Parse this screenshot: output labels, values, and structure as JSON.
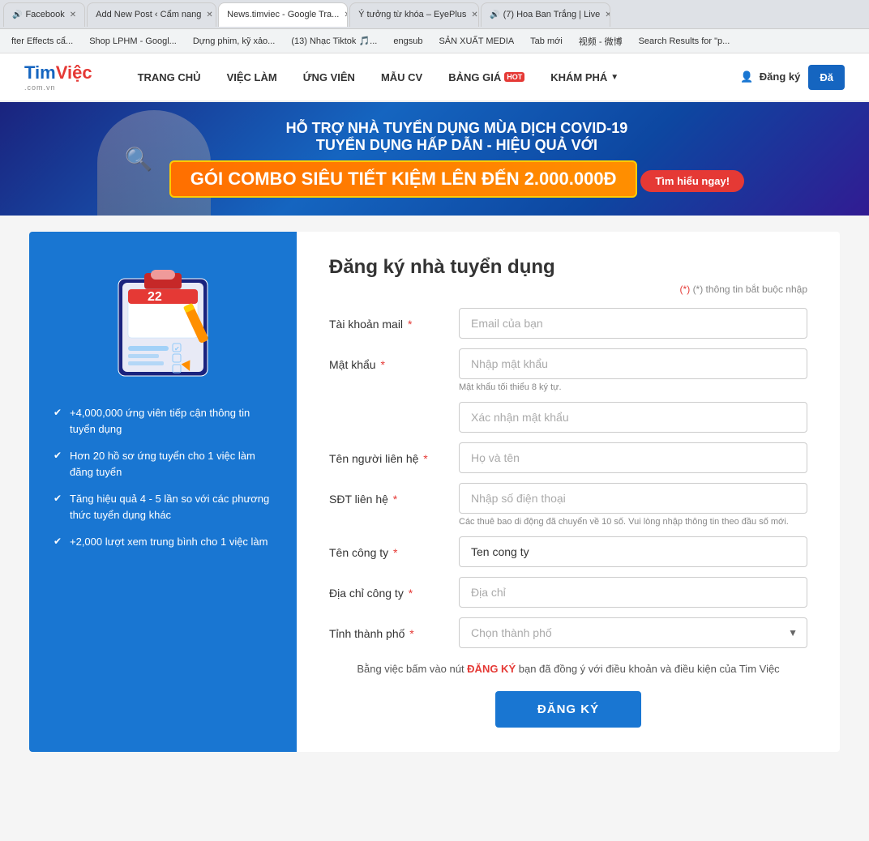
{
  "browser": {
    "tabs": [
      {
        "label": "Facebook",
        "active": false,
        "audio": true
      },
      {
        "label": "Add New Post ‹ Cẩm nang",
        "active": false,
        "audio": false
      },
      {
        "label": "News.timviec - Google Tra...",
        "active": true,
        "audio": false
      },
      {
        "label": "Ý tưởng từ khóa – EyePlus",
        "active": false,
        "audio": false
      },
      {
        "label": "(7) Hoa Ban Trắng | Live",
        "active": false,
        "audio": true
      }
    ],
    "bookmarks": [
      "fter Effects cẩ...",
      "Shop LPHM - Googl...",
      "Dựng phim, kỹ xảo...",
      "(13) Nhạc Tiktok 🎵...",
      "engsub",
      "SẢN XUẤT MEDIA",
      "Tab mới",
      "视频 - 微博",
      "Search Results for \"p..."
    ]
  },
  "header": {
    "logo": "TimViệc",
    "logo_sub": ".com.vn",
    "nav_items": [
      "TRANG CHỦ",
      "VIỆC LÀM",
      "ỨNG VIÊN",
      "MẪU CV",
      "BẢNG GIÁ",
      "KHÁM PHÁ"
    ],
    "bảng_giá_badge": "HOT",
    "btn_dangky": "Đăng ký",
    "btn_dangnhap": "Đă"
  },
  "banner": {
    "line1": "HỖ TRỢ NHÀ TUYỂN DỤNG MÙA DỊCH COVID-19",
    "line2": "TUYỂN DỤNG HẤP DẪN - HIỆU QUẢ VỚI",
    "cta": "GÓI COMBO SIÊU TIẾT KIỆM LÊN ĐẾN 2.000.000Đ",
    "btn": "Tìm hiểu ngay!"
  },
  "left_panel": {
    "features": [
      "+4,000,000 ứng viên tiếp cận thông tin tuyển dụng",
      "Hơn 20 hồ sơ ứng tuyển cho 1 việc làm đăng tuyển",
      "Tăng hiệu quả 4 - 5 lần so với các phương thức tuyển dụng khác",
      "+2,000 lượt xem trung bình cho 1 việc làm"
    ]
  },
  "form": {
    "title": "Đăng ký nhà tuyển dụng",
    "required_note": "(*) thông tin bắt buộc nhập",
    "fields": {
      "email_label": "Tài khoản mail",
      "email_placeholder": "Email của bạn",
      "password_label": "Mật khẩu",
      "password_placeholder": "Nhập mật khẩu",
      "password_hint": "Mật khẩu tối thiểu 8 ký tự.",
      "confirm_placeholder": "Xác nhận mật khẩu",
      "contact_label": "Tên người liên hệ",
      "contact_placeholder": "Họ và tên",
      "phone_label": "SĐT liên hệ",
      "phone_placeholder": "Nhập số điện thoại",
      "phone_hint": "Các thuê bao di động đã chuyển về 10 số. Vui lòng nhập thông tin theo đầu số mới.",
      "company_label": "Tên công ty",
      "company_placeholder": "Tên công ty",
      "company_value": "Ten cong ty",
      "address_label": "Địa chỉ công ty",
      "address_placeholder": "Địa chỉ",
      "city_label": "Tỉnh thành phố",
      "city_placeholder": "Chọn thành phố"
    },
    "agreement": "Bằng việc bấm vào nút \"ĐĂNG KÝ\" bạn đã đồng ý với điều khoản và điều kiện của Tim Việc",
    "agreement_highlight": "ĐĂNG KÝ",
    "submit_btn": "ĐĂNG KÝ"
  }
}
